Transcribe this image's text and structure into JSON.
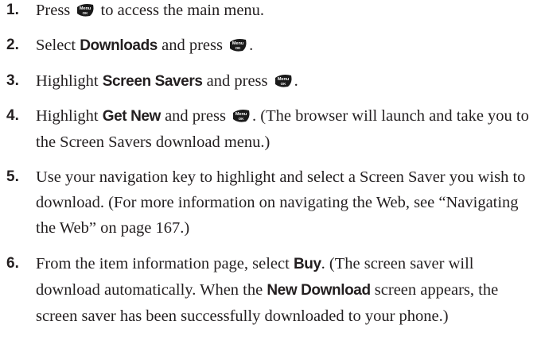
{
  "key_icon": {
    "name": "menu-ok-key-icon",
    "top_label": "Menu",
    "bottom_label": "OK",
    "color": "#1a1a1a"
  },
  "steps": [
    {
      "number": "1.",
      "t1": "Press ",
      "t2": " to access the main menu."
    },
    {
      "number": "2.",
      "t1": "Select ",
      "b1": "Downloads",
      "t2": " and press ",
      "t3": "."
    },
    {
      "number": "3.",
      "t1": "Highlight ",
      "b1": "Screen Savers",
      "t2": " and press ",
      "t3": "."
    },
    {
      "number": "4.",
      "t1": "Highlight ",
      "b1": "Get New",
      "t2": " and press ",
      "t3": ". (The browser will launch and take you to the Screen Savers download menu.)"
    },
    {
      "number": "5.",
      "t1": "Use your navigation key to highlight and select a Screen Saver you wish to download. (For more information on navigating the Web, see “Navigating the Web” on page 167.)"
    },
    {
      "number": "6.",
      "t1": "From the item information page, select ",
      "b1": "Buy",
      "t2": ". (The screen saver will download automatically. When the ",
      "b2": "New Download",
      "t3": " screen appears, the screen saver has been successfully downloaded to your phone.)"
    }
  ]
}
